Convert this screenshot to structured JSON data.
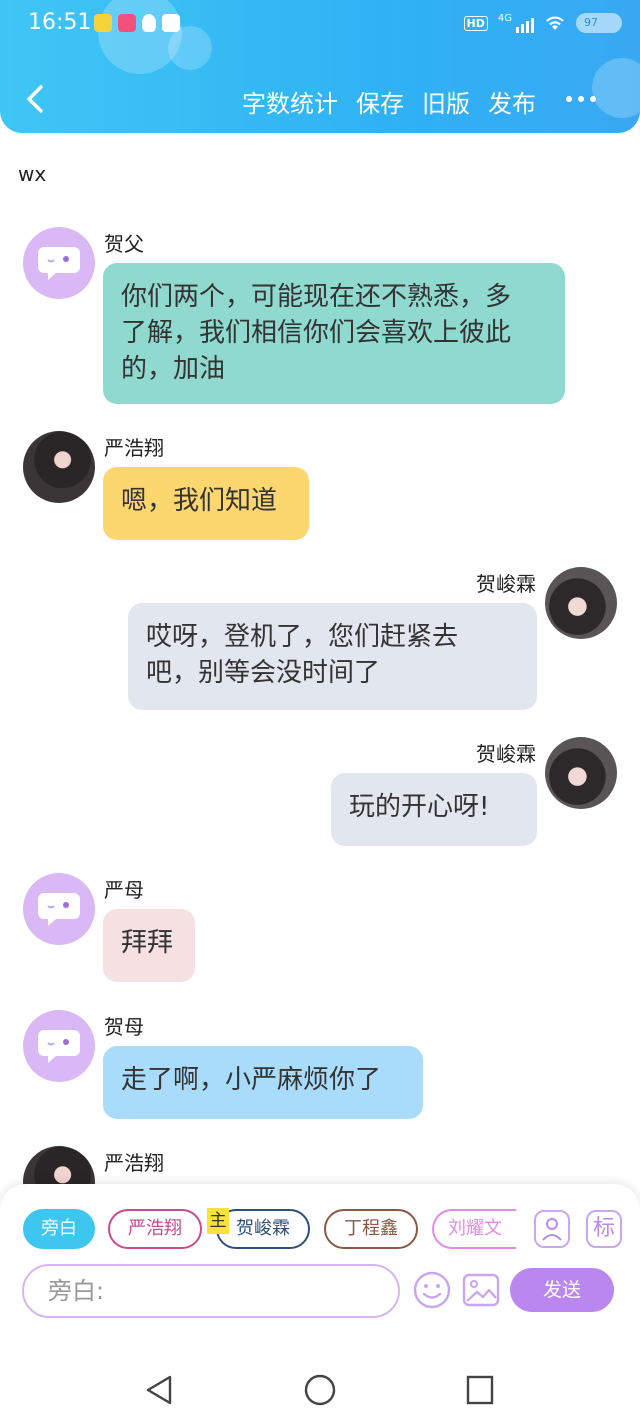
{
  "status_bar": {
    "time": "16:51",
    "network": "4G",
    "hd": "HD",
    "battery": "97"
  },
  "header": {
    "actions": [
      "字数统计",
      "保存",
      "旧版",
      "发布"
    ]
  },
  "chat": {
    "title": "wx",
    "messages": [
      {
        "name": "贺父",
        "text_lines": [
          "你们两个，可能现在还不熟悉，多",
          "了解，我们相信你们会喜欢上彼此",
          "的，加油"
        ],
        "side": "left",
        "bubble_color": "#8fd9cf"
      },
      {
        "name": "严浩翔",
        "text_lines": [
          "嗯，我们知道"
        ],
        "side": "left",
        "bubble_color": "#fcd66e"
      },
      {
        "name": "贺峻霖",
        "text_lines": [
          "哎呀，登机了，您们赶紧去",
          "吧，别等会没时间了"
        ],
        "side": "right",
        "bubble_color": "#e2e6ee"
      },
      {
        "name": "贺峻霖",
        "text_lines": [
          "玩的开心呀!"
        ],
        "side": "right",
        "bubble_color": "#e2e6ee"
      },
      {
        "name": "严母",
        "text_lines": [
          "拜拜"
        ],
        "side": "left",
        "bubble_color": "#f5e1e2"
      },
      {
        "name": "贺母",
        "text_lines": [
          "走了啊，小严麻烦你了"
        ],
        "side": "left",
        "bubble_color": "#a9dcfb"
      },
      {
        "name": "严浩翔",
        "text_lines": [],
        "side": "left",
        "bubble_color": ""
      }
    ]
  },
  "roles": {
    "chips": [
      "旁白",
      "严浩翔",
      "贺峻霖",
      "丁程鑫",
      "刘耀文"
    ],
    "main_badge": "主",
    "tag_label": "标"
  },
  "composer": {
    "placeholder": "旁白:",
    "send_label": "发送"
  },
  "colors": {
    "header": "#33b8f4",
    "accent": "#b987ee",
    "narration_chip": "#3fc6f0"
  }
}
